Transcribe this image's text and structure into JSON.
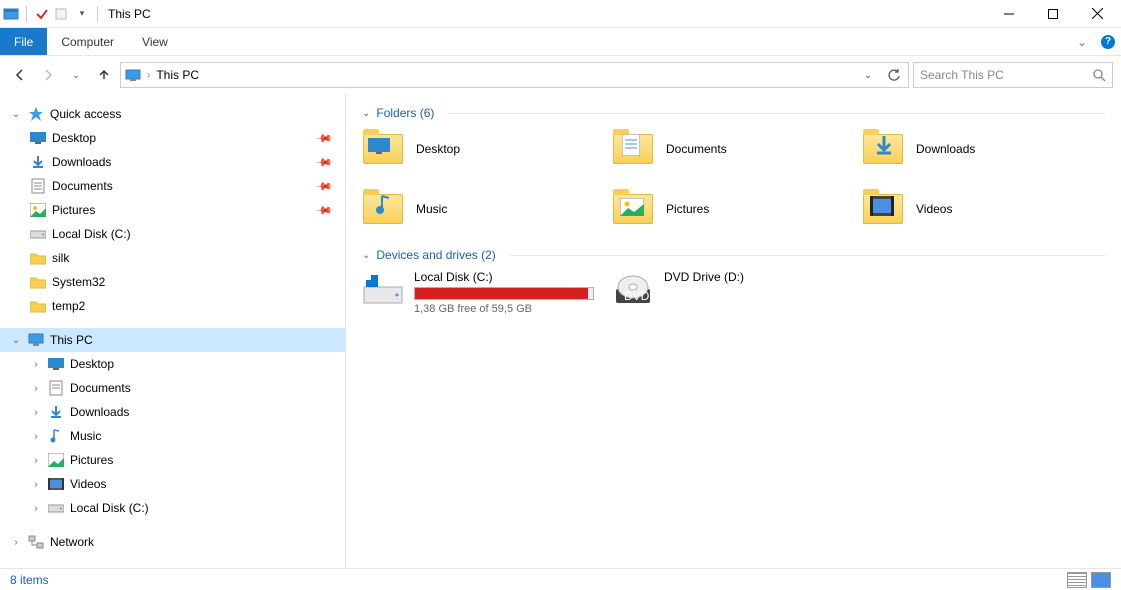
{
  "titlebar": {
    "title": "This PC"
  },
  "ribbon": {
    "file": "File",
    "computer": "Computer",
    "view": "View"
  },
  "address": {
    "crumb": "This PC"
  },
  "search": {
    "placeholder": "Search This PC"
  },
  "nav": {
    "quick_access": "Quick access",
    "qa_items": [
      {
        "label": "Desktop",
        "pinned": true
      },
      {
        "label": "Downloads",
        "pinned": true
      },
      {
        "label": "Documents",
        "pinned": true
      },
      {
        "label": "Pictures",
        "pinned": true
      },
      {
        "label": "Local Disk (C:)",
        "pinned": false
      },
      {
        "label": "silk",
        "pinned": false
      },
      {
        "label": "System32",
        "pinned": false
      },
      {
        "label": "temp2",
        "pinned": false
      }
    ],
    "this_pc": "This PC",
    "pc_items": [
      {
        "label": "Desktop"
      },
      {
        "label": "Documents"
      },
      {
        "label": "Downloads"
      },
      {
        "label": "Music"
      },
      {
        "label": "Pictures"
      },
      {
        "label": "Videos"
      },
      {
        "label": "Local Disk (C:)"
      }
    ],
    "network": "Network"
  },
  "groups": {
    "folders_hdr": "Folders (6)",
    "folders": [
      {
        "label": "Desktop"
      },
      {
        "label": "Documents"
      },
      {
        "label": "Downloads"
      },
      {
        "label": "Music"
      },
      {
        "label": "Pictures"
      },
      {
        "label": "Videos"
      }
    ],
    "drives_hdr": "Devices and drives (2)",
    "drives": [
      {
        "label": "Local Disk (C:)",
        "free_text": "1,38 GB free of 59,5 GB",
        "fill_pct": 97
      },
      {
        "label": "DVD Drive (D:)"
      }
    ]
  },
  "status": {
    "text": "8 items"
  }
}
